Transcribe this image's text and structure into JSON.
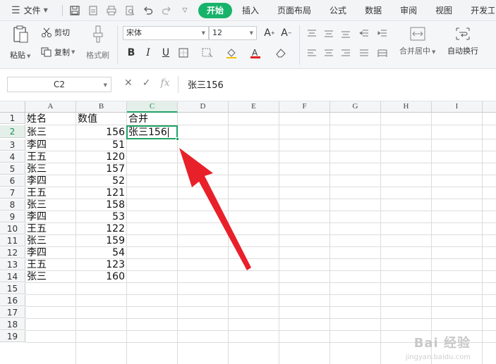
{
  "menu": {
    "file_label": "文件",
    "tabs": [
      "开始",
      "插入",
      "页面布局",
      "公式",
      "数据",
      "审阅",
      "视图",
      "开发工具"
    ]
  },
  "ribbon": {
    "paste_label": "粘贴",
    "cut_label": "剪切",
    "copy_label": "复制",
    "format_painter_label": "格式刷",
    "font_name": "宋体",
    "font_size": "12",
    "merge_center_label": "合并居中",
    "wrap_text_label": "自动换行"
  },
  "formula_bar": {
    "name_box": "C2",
    "formula": "张三156"
  },
  "sheet": {
    "columns": [
      "A",
      "B",
      "C",
      "D",
      "E",
      "F",
      "G",
      "H",
      "I"
    ],
    "rows": [
      "1",
      "2",
      "3",
      "4",
      "5",
      "6",
      "7",
      "8",
      "9",
      "10",
      "11",
      "12",
      "13",
      "14",
      "15",
      "16",
      "17",
      "18",
      "19"
    ],
    "header_row": [
      "姓名",
      "数值",
      "合并"
    ],
    "data": [
      [
        "张三",
        "156"
      ],
      [
        "李四",
        "51"
      ],
      [
        "王五",
        "120"
      ],
      [
        "张三",
        "157"
      ],
      [
        "李四",
        "52"
      ],
      [
        "王五",
        "121"
      ],
      [
        "张三",
        "158"
      ],
      [
        "李四",
        "53"
      ],
      [
        "王五",
        "122"
      ],
      [
        "张三",
        "159"
      ],
      [
        "李四",
        "54"
      ],
      [
        "王五",
        "123"
      ],
      [
        "张三",
        "160"
      ]
    ],
    "active_cell_value": "张三156",
    "selected_column": "C",
    "selected_row": "2"
  },
  "annotation": {
    "arrow_color": "#e8202a"
  },
  "watermark": {
    "text": "Bai 经验",
    "sub": "jingyan.baidu.com"
  }
}
